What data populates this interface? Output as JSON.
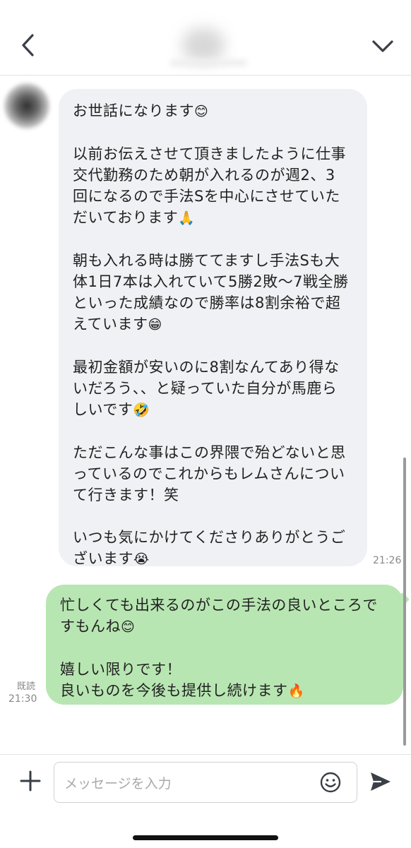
{
  "incoming": {
    "paragraphs": [
      {
        "text": "お世話になります",
        "emoji": "😊"
      },
      {
        "text": "以前お伝えさせて頂きましたように仕事\n交代勤務のため朝が入れるのが週2、3\n回になるので手法Sを中心にさせていた\nだいております",
        "emoji": "🙏"
      },
      {
        "text": "朝も入れる時は勝ててますし手法Sも大\n体1日7本は入れていて5勝2敗〜7戦全勝\nといった成績なので勝率は8割余裕で超\nえています",
        "emoji": "😁"
      },
      {
        "text": "最初金額が安いのに8割なんてあり得な\nいだろう、、と疑っていた自分が馬鹿ら\nしいです",
        "emoji": "🤣"
      },
      {
        "text": "ただこんな事はこの界隈で殆どないと思\nっているのでこれからもレムさんについ\nて行きます！笑",
        "emoji": ""
      },
      {
        "text": "いつも気にかけてくださりありがとうご\nざいます",
        "emoji": "😭"
      }
    ],
    "time": "21:26"
  },
  "outgoing": {
    "paragraphs": [
      {
        "text": "忙しくても出来るのがこの手法の良いところで\nすもんね",
        "emoji": "😊"
      },
      {
        "text": "嬉しい限りです！\n良いものを今後も提供し続けます",
        "emoji": "🔥"
      }
    ],
    "read_label": "既読",
    "time": "21:30"
  },
  "input": {
    "placeholder": "メッセージを入力",
    "value": ""
  },
  "icons": {
    "back": "chevron-left-icon",
    "menu": "chevron-down-icon",
    "plus": "plus-icon",
    "emoji": "smiley-icon",
    "send": "send-icon"
  },
  "colors": {
    "incoming_bubble": "#f0f1f4",
    "outgoing_bubble": "#b8e6b2",
    "icon": "#3a3f47"
  }
}
